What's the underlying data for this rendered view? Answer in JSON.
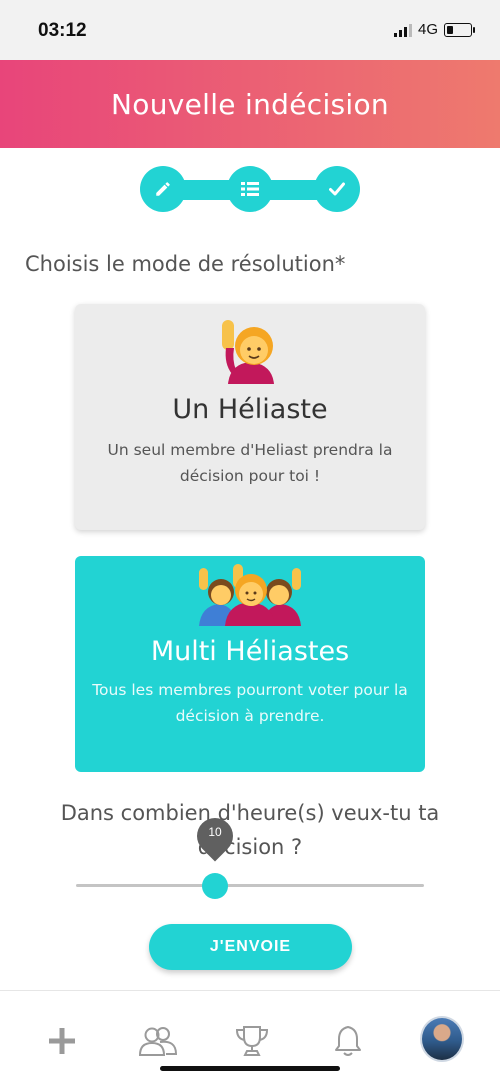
{
  "status": {
    "time": "03:12",
    "network": "4G"
  },
  "header": {
    "title": "Nouvelle indécision"
  },
  "stepper": {
    "steps": [
      "pencil-icon",
      "list-icon",
      "check-icon"
    ]
  },
  "mode_label": "Choisis le mode de résolution*",
  "cards": [
    {
      "title": "Un Héliaste",
      "desc": "Un seul membre d'Heliast prendra la décision pour toi !",
      "emoji": "person-raising-hand",
      "selected": false
    },
    {
      "title": "Multi Héliastes",
      "desc": "Tous les membres pourront voter pour la décision à prendre.",
      "emoji": "group-raising-hands",
      "selected": true
    }
  ],
  "hours": {
    "question": "Dans combien d'heure(s) veux-tu ta décision ?",
    "value": "10",
    "fraction": 0.4
  },
  "send_button": "J'ENVOIE",
  "colors": {
    "accent": "#22d3d3",
    "header_start": "#e8457a",
    "header_end": "#ee7a6e"
  },
  "tabbar": [
    "plus-icon",
    "users-icon",
    "trophy-icon",
    "bell-icon",
    "avatar"
  ]
}
